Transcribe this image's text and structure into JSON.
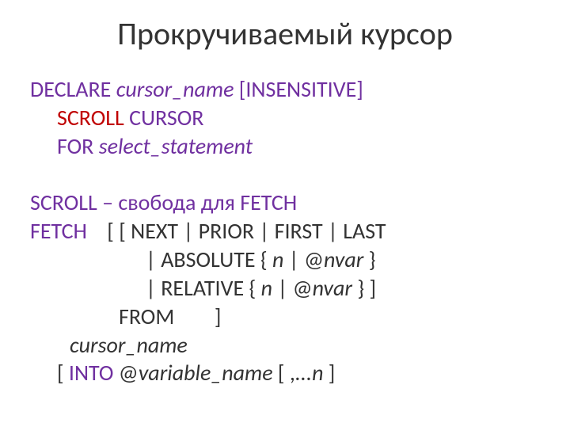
{
  "title": "Прокручиваемый курсор",
  "declare": {
    "kw": "DECLARE ",
    "cursor": "cursor_name ",
    "insensitive": "[INSENSITIVE]",
    "scroll": "SCROLL ",
    "cursorkw": "CURSOR",
    "for": "FOR ",
    "select": "select_statement"
  },
  "scroll_note": {
    "p1": "SCROLL – свобода для ",
    "p2": "FETCH"
  },
  "fetch": {
    "f1a": "FETCH",
    "f1b": "    [ [ NEXT | PRIOR | FIRST | LAST",
    "f2a": "| ABSOLUTE { ",
    "f2n": "n ",
    "f2pipe": "| ",
    "f2at": "@",
    "f2nvar": "nvar ",
    "f2close": "}",
    "f3a": "| RELATIVE { ",
    "f3n": "n ",
    "f3pipe": "| ",
    "f3at": "@",
    "f3nvar": "nvar ",
    "f3close": "}   ]",
    "f4": "FROM        ]",
    "f5": "cursor_name",
    "f6a": "[ ",
    "f6into": "INTO ",
    "f6at": "@",
    "f6var": "variable_name ",
    "f6b": "[ ",
    "f6comma": ",",
    "f6dots": "...",
    "f6n": "n ",
    "f6c": "]"
  }
}
